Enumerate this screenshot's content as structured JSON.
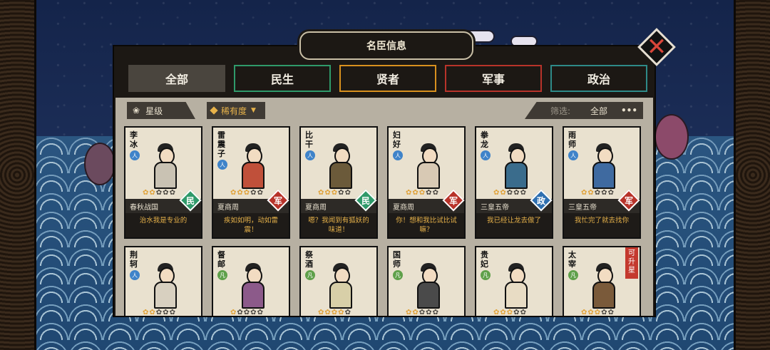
{
  "colors": {
    "min": "#2f9a6a",
    "xian": "#d8901e",
    "jun": "#b8332a",
    "zheng": "#2e8a88"
  },
  "header": {
    "title": "名臣信息",
    "close_icon": "close-icon"
  },
  "tabs": [
    {
      "label": "全部",
      "active": true
    },
    {
      "label": "民生",
      "color": "#2f9a6a"
    },
    {
      "label": "贤者",
      "color": "#d8901e"
    },
    {
      "label": "军事",
      "color": "#b8332a"
    },
    {
      "label": "政治",
      "color": "#2e8a88"
    }
  ],
  "filters": {
    "star_label": "星级",
    "rarity_label": "稀有度",
    "filter_prefix": "筛选:",
    "filter_value": "全部",
    "more_icon": "more-dots-icon"
  },
  "cards": [
    {
      "name": "李冰",
      "rank": "人",
      "rank_color": "blue",
      "stars": 2,
      "era": "春秋战国",
      "type": "民",
      "type_color": "#2f9a6a",
      "quote": "治水我是专业的",
      "robe": "#c9c2b3"
    },
    {
      "name": "雷震子",
      "rank": "人",
      "rank_color": "blue",
      "stars": 3,
      "era": "夏商周",
      "type": "军",
      "type_color": "#b8332a",
      "quote": "疾如如明，动如雷震！",
      "robe": "#c0503a"
    },
    {
      "name": "比干",
      "rank": "人",
      "rank_color": "blue",
      "stars": 3,
      "era": "夏商周",
      "type": "民",
      "type_color": "#2f9a6a",
      "quote": "嗯？我闻到有狐妖的味道！",
      "robe": "#6b5a3a"
    },
    {
      "name": "妇好",
      "rank": "人",
      "rank_color": "blue",
      "stars": 3,
      "era": "夏商周",
      "type": "军",
      "type_color": "#b8332a",
      "quote": "你！想和我比试比试嘛？",
      "robe": "#d8c9b4"
    },
    {
      "name": "拳龙",
      "rank": "人",
      "rank_color": "blue",
      "stars": 2,
      "era": "三皇五帝",
      "type": "政",
      "type_color": "#2e6fb0",
      "quote": "我已经让龙去做了",
      "robe": "#3a6c8c"
    },
    {
      "name": "雨师",
      "rank": "人",
      "rank_color": "blue",
      "stars": 2,
      "era": "三皇五帝",
      "type": "军",
      "type_color": "#b8332a",
      "quote": "我忙完了就去找你",
      "robe": "#3f6aa0"
    },
    {
      "name": "荆轲",
      "rank": "人",
      "rank_color": "blue",
      "stars": 2,
      "robe": "#d8d0c0"
    },
    {
      "name": "督邮",
      "rank": "凡",
      "rank_color": "green",
      "stars": 1,
      "robe": "#8c5a8a"
    },
    {
      "name": "祭酒",
      "rank": "凡",
      "rank_color": "green",
      "stars": 4,
      "robe": "#d8cfa8"
    },
    {
      "name": "国师",
      "rank": "凡",
      "rank_color": "green",
      "stars": 2,
      "robe": "#4a4a4a"
    },
    {
      "name": "贵妃",
      "rank": "凡",
      "rank_color": "green",
      "stars": 3,
      "robe": "#e8dcc4"
    },
    {
      "name": "太宰",
      "rank": "凡",
      "rank_color": "green",
      "stars": 3,
      "robe": "#7a5a3a",
      "upgrade": "可升星"
    }
  ]
}
